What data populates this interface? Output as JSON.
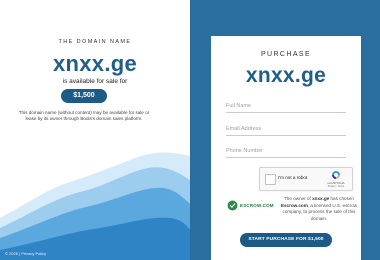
{
  "left_panel": {
    "eyebrow": "THE DOMAIN NAME",
    "domain": "xnxx.ge",
    "availability": "is available for sale for",
    "price": "$1,500",
    "disclaimer": "This domain name (without content) may be available for sale or lease by its owner through Bodis's domain sales platform.",
    "copyright": "© 2025 | Privacy Policy"
  },
  "purchase_card": {
    "title": "PURCHASE",
    "domain": "xnxx.ge",
    "fields": [
      {
        "placeholder": "Full Name"
      },
      {
        "placeholder": "Email Address"
      },
      {
        "placeholder": "Phone Number"
      }
    ],
    "recaptcha": {
      "label": "I'm not a robot",
      "brand": "reCAPTCHA",
      "terms": "Privacy - Terms"
    },
    "escrow": {
      "logo_text": "ESCROW.COM",
      "text_prefix": "The owner of ",
      "domain": "xnxx.ge",
      "text_middle": " has chosen ",
      "escrow_name": "Escrow.com",
      "text_suffix": ", a licensed U.S. escrow company, to process the sale of this domain."
    },
    "button_label": "START PURCHASE FOR $1,500"
  },
  "colors": {
    "accent": "#1f5f8a",
    "button": "#1e5a86",
    "right_background": "#2a6e9f",
    "waves": [
      "#d6ebf9",
      "#9ccdee",
      "#5aa8dd",
      "#2f84c5"
    ]
  },
  "icons": {
    "recaptcha": "recaptcha-logo-icon",
    "escrow": "escrow-shield-icon"
  }
}
